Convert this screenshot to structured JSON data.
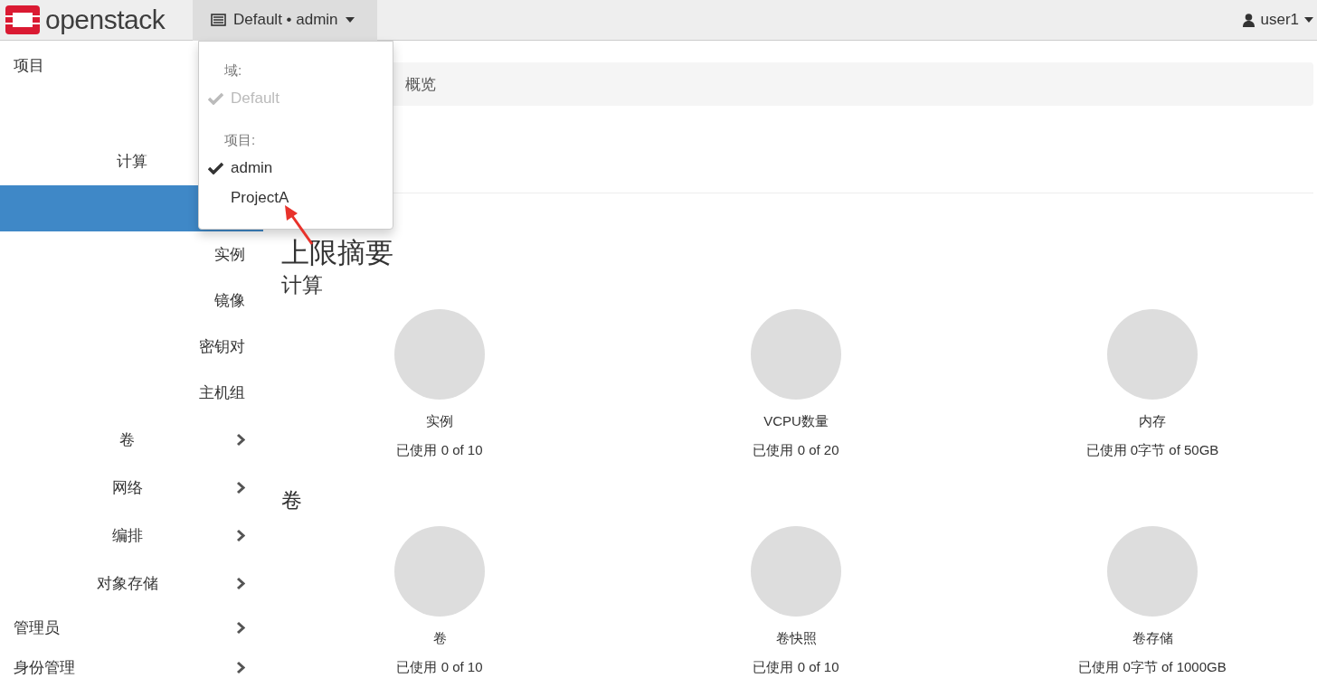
{
  "topbar": {
    "logo": "openstack",
    "context_menu": "Default • admin",
    "user_menu": "user1"
  },
  "context_dropdown": {
    "groups": [
      {
        "header": "域:",
        "items": [
          {
            "label": "Default",
            "checked": true,
            "disabled": true
          }
        ]
      },
      {
        "header": "项目:",
        "items": [
          {
            "label": "admin",
            "checked": true,
            "disabled": false
          },
          {
            "label": "ProjectA",
            "checked": false,
            "disabled": false
          }
        ]
      }
    ]
  },
  "sidebar": {
    "items": [
      {
        "label": "项目",
        "children": [
          {
            "label": "计算",
            "children": [
              {
                "selected": true
              },
              {
                "label": "实例",
                "selected": false
              },
              {
                "label": "镜像",
                "selected": false
              },
              {
                "label": "密钥对",
                "selected": false
              },
              {
                "label": "主机组",
                "selected": false
              }
            ]
          },
          {
            "label": "卷"
          },
          {
            "label": "网络"
          },
          {
            "label": "编排"
          },
          {
            "label": "对象存储"
          }
        ]
      },
      {
        "label": "管理员"
      },
      {
        "label": "身份管理"
      }
    ]
  },
  "breadcrumb": "概览",
  "limit_summary": {
    "title": "上限摘要",
    "sections": [
      {
        "title": "计算",
        "quotas": [
          {
            "name": "实例",
            "usage": "已使用 0 of 10"
          },
          {
            "name": "VCPU数量",
            "usage": "已使用 0 of 20"
          },
          {
            "name": "内存",
            "usage": "已使用 0字节 of 50GB"
          }
        ]
      },
      {
        "title": "卷",
        "quotas": [
          {
            "name": "卷",
            "usage": "已使用 0 of 10"
          },
          {
            "name": "卷快照",
            "usage": "已使用 0 of 10"
          },
          {
            "name": "卷存储",
            "usage": "已使用 0字节 of 1000GB"
          }
        ]
      }
    ]
  }
}
